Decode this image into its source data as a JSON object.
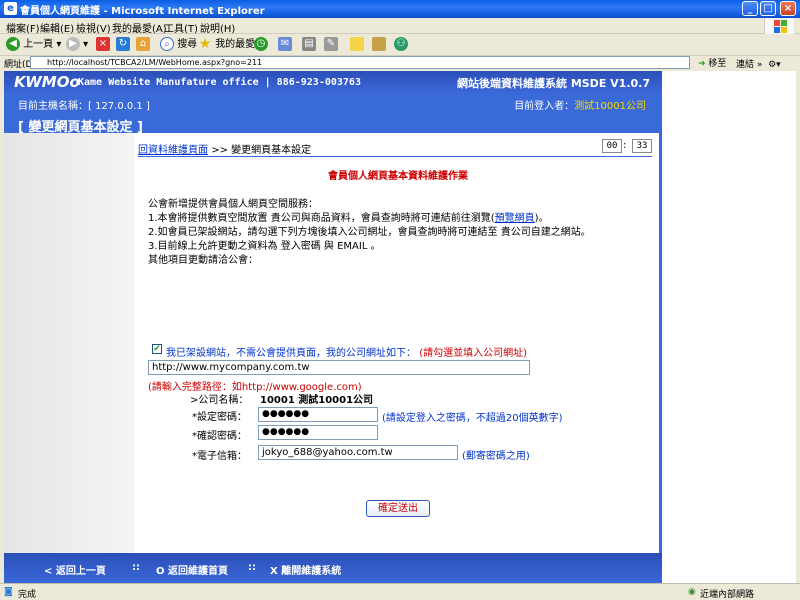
{
  "window": {
    "title": "會員個人網頁維護 - Microsoft Internet Explorer"
  },
  "menu": [
    "檔案(F)",
    "編輯(E)",
    "檢視(V)",
    "我的最愛(A)",
    "工具(T)",
    "說明(H)"
  ],
  "toolbar": {
    "back": "上一頁",
    "search": "搜尋",
    "favorites": "我的最愛"
  },
  "address": {
    "label": "網址(D)",
    "url": "http://localhost/TCBCA2/LM/WebHome.aspx?gno=211",
    "go": "移至",
    "links": "連結"
  },
  "header": {
    "logo": "KWMOo",
    "brand": "Kame Website Manufature office | 886-923-003763",
    "system": "網站後端資料維護系統 MSDE V1.0.7",
    "host_label": "目前主機名稱：[ 127.0.0.1 ]",
    "login_label": "目前登入者：",
    "login_user": "測試10001公司",
    "page_title": "[ 變更網頁基本設定 ]"
  },
  "breadcrumb": {
    "link": "回資料維護頁面",
    "sep": ">>",
    "current": "變更網頁基本設定"
  },
  "timer": {
    "min": "00",
    "sep": ":",
    "sec": "33"
  },
  "form": {
    "title": "會員個人網頁基本資料維護作業",
    "intro": "公會新增提供會員個人網頁空間服務：",
    "line1a": "1.本會將提供數頁空間放置 貴公司與商品資料，會員查詢時將可連結前往瀏覽(",
    "line1_link": "預覽網頁",
    "line1b": ")。",
    "line2": "2.如會員已架設網站，請勾選下列方塊後填入公司網址，會員查詢時將可連結至 貴公司自建之網站。",
    "line3": "3.目前線上允許更動之資料為 登入密碼 與 EMAIL 。",
    "line4": "其他項目更動請洽公會：",
    "check_label": "我已架設網站，不需公會提供頁面，我的公司網址如下：",
    "check_hint": "(請勾選並填入公司網址)",
    "url_value": "http://www.mycompany.com.tw",
    "url_hint": "(請輸入完整路徑：如http://www.google.com)",
    "company_label": ">公司名稱：",
    "company_value": "10001 測試10001公司",
    "pw_label": "*設定密碼：",
    "pw_value": "●●●●●●",
    "pw_hint": "(請設定登入之密碼，不超過20個英數字)",
    "pw2_label": "*確認密碼：",
    "pw2_value": "●●●●●●",
    "email_label": "*電子信箱：",
    "email_value": "jokyo_688@yahoo.com.tw",
    "email_hint": "(郵寄密碼之用)",
    "submit": "確定送出"
  },
  "footer": {
    "back": "< 返回上一頁",
    "sep1": "::",
    "home": "O 返回維護首頁",
    "sep2": "::",
    "exit": "X 離開維護系統"
  },
  "status": {
    "text": "完成",
    "zone": "近端內部網路"
  }
}
